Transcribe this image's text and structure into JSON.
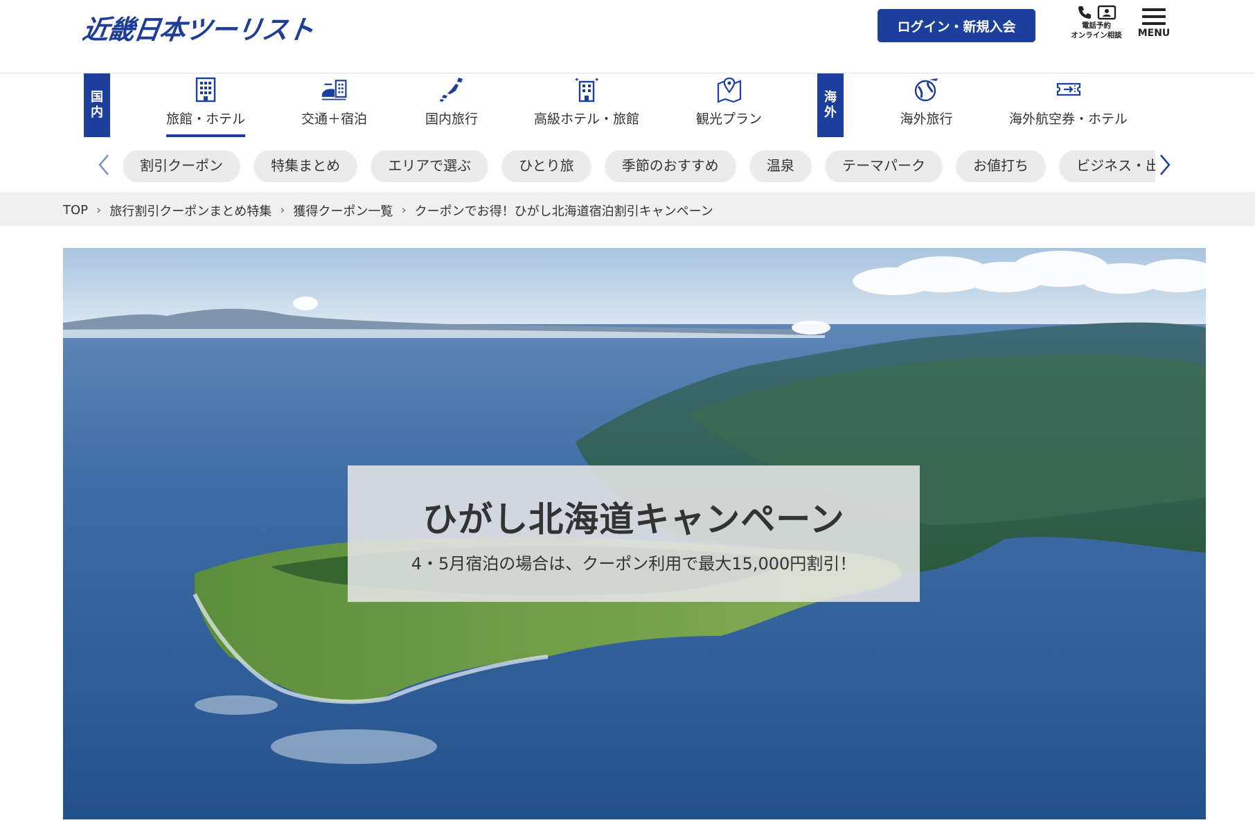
{
  "header": {
    "logo": "近畿日本ツーリスト",
    "login_button": "ログイン・新規入会",
    "phone_label_1": "電話予約",
    "phone_label_2": "オンライン相談",
    "menu_label": "MENU"
  },
  "category_nav": {
    "domestic_tag": [
      "国",
      "内"
    ],
    "overseas_tag": [
      "海",
      "外"
    ],
    "domestic_items": [
      {
        "label": "旅館・ホテル",
        "icon": "building-icon",
        "active": true
      },
      {
        "label": "交通＋宿泊",
        "icon": "train-hotel-icon"
      },
      {
        "label": "国内旅行",
        "icon": "japan-map-icon"
      },
      {
        "label": "高級ホテル・旅館",
        "icon": "luxury-hotel-icon"
      },
      {
        "label": "観光プラン",
        "icon": "map-pin-icon"
      }
    ],
    "overseas_items": [
      {
        "label": "海外旅行",
        "icon": "globe-plane-icon"
      },
      {
        "label": "海外航空券・ホテル",
        "icon": "ticket-icon"
      }
    ]
  },
  "tags": [
    "割引クーポン",
    "特集まとめ",
    "エリアで選ぶ",
    "ひとり旅",
    "季節のおすすめ",
    "温泉",
    "テーマパーク",
    "お値打ち",
    "ビジネス・出張"
  ],
  "breadcrumb": [
    "TOP",
    "旅行割引クーポンまとめ特集",
    "獲得クーポン一覧",
    "クーポンでお得！ひがし北海道宿泊割引キャンペーン"
  ],
  "hero": {
    "title": "ひがし北海道キャンペーン",
    "subtitle": "4・5月宿泊の場合は、クーポン利用で最大15,000円割引！"
  },
  "colors": {
    "brand": "#1c3f9b",
    "tag_bg": "#ebebeb",
    "crumb_bg": "#f0f0f0"
  }
}
